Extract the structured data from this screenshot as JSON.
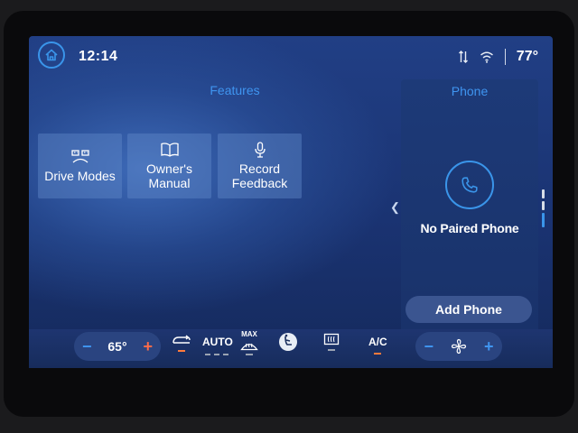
{
  "status": {
    "time": "12:14",
    "temperature": "77°"
  },
  "features": {
    "title": "Features",
    "tiles": [
      {
        "label": "Drive Modes",
        "icon": "drive-modes-icon"
      },
      {
        "label": "Owner's\nManual",
        "icon": "book-icon"
      },
      {
        "label": "Record\nFeedback",
        "icon": "microphone-icon"
      }
    ]
  },
  "phone": {
    "title": "Phone",
    "status": "No Paired Phone",
    "add_label": "Add Phone"
  },
  "climate": {
    "temp": "65°",
    "minus": "−",
    "plus": "+",
    "auto_label": "AUTO",
    "max_label": "MAX",
    "ac_label": "A/C"
  },
  "colors": {
    "accent": "#3a95ea",
    "plus": "#ff6b4a",
    "indicator_on": "#ff7a3c"
  }
}
